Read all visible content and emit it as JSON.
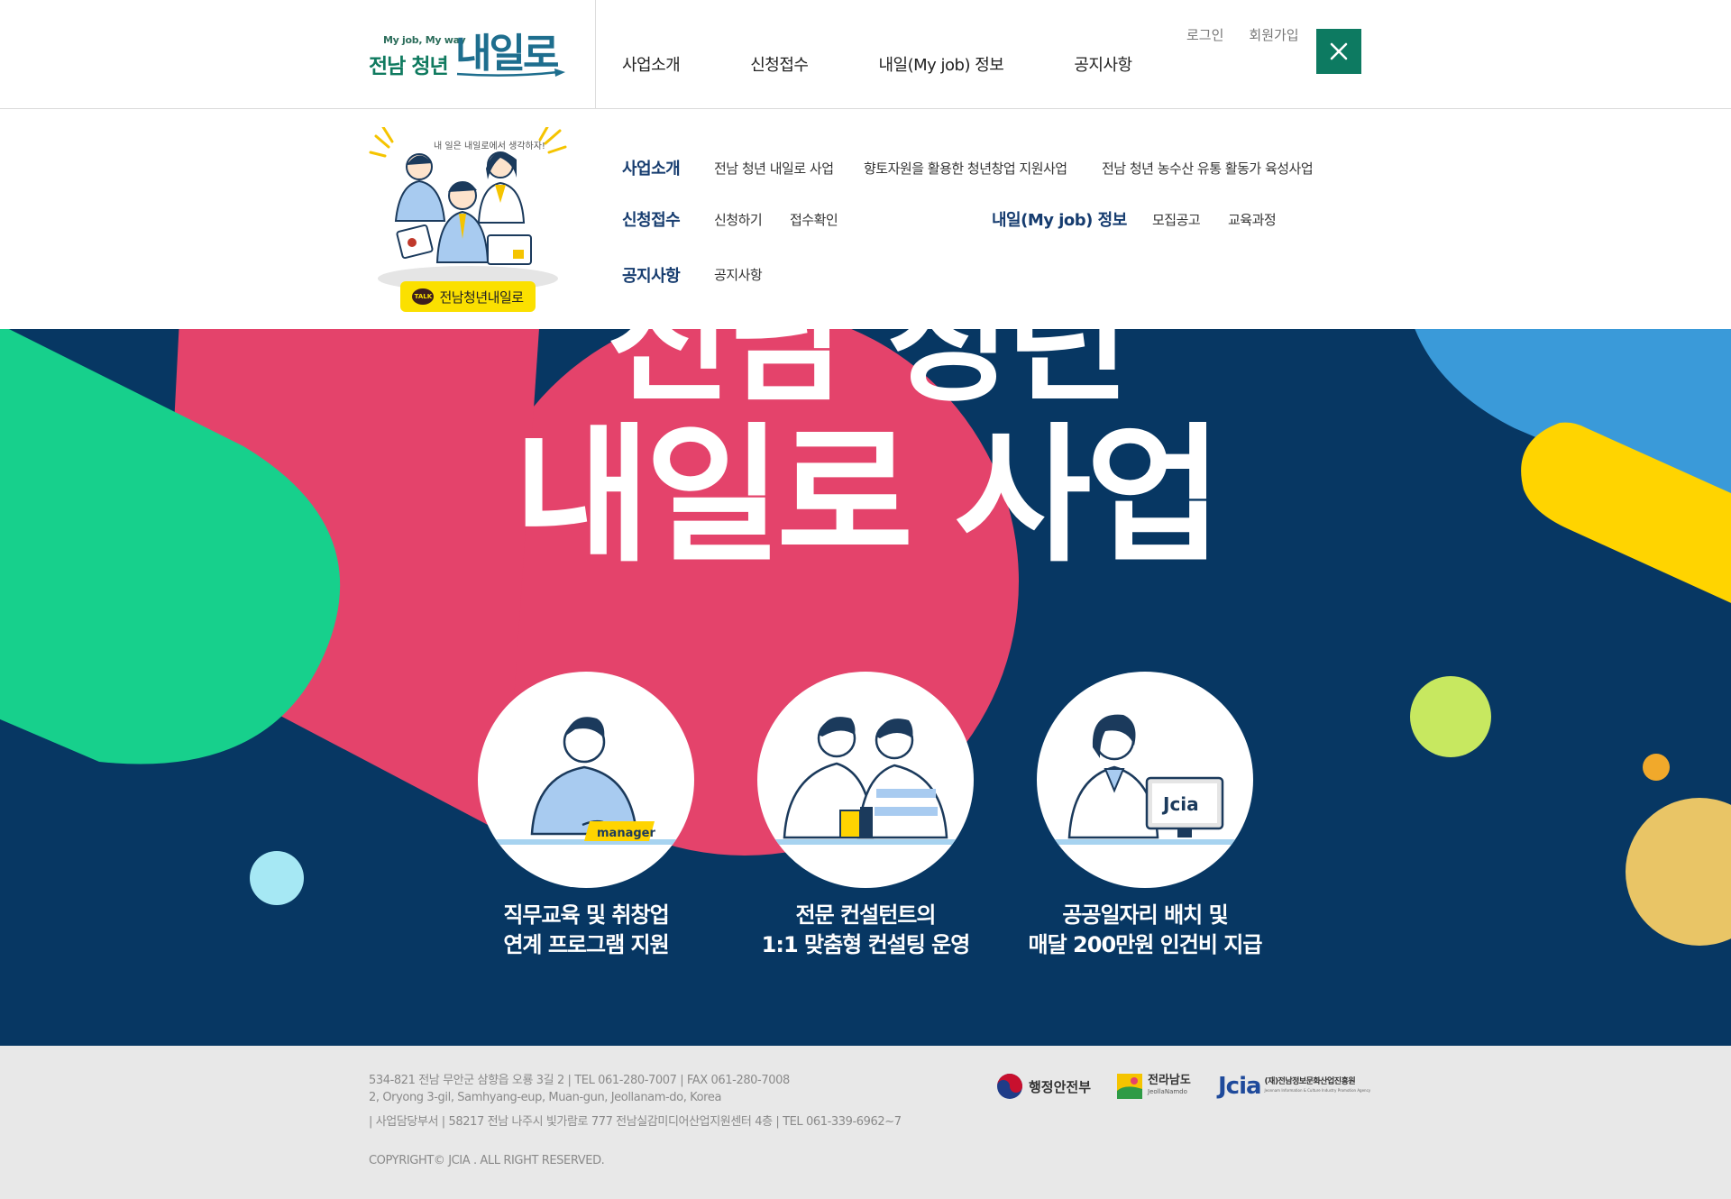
{
  "header": {
    "logo_sub": "My job, My way",
    "logo_main": "전남 청년",
    "logo_big": "내일로",
    "nav": [
      "사업소개",
      "신청접수",
      "내일(My job) 정보",
      "공지사항"
    ],
    "login": "로그인",
    "signup": "회원가입"
  },
  "mega": {
    "illust_caption": "내 일은 내일로에서 생각하자!",
    "kakao_badge": "TALK",
    "kakao_label": "전남청년내일로",
    "business": {
      "title": "사업소개",
      "links": [
        "전남 청년 내일로 사업",
        "향토자원을 활용한 청년창업 지원사업",
        "전남 청년 농수산 유통 활동가 육성사업"
      ]
    },
    "apply": {
      "title": "신청접수",
      "links": [
        "신청하기",
        "접수확인"
      ]
    },
    "info": {
      "title": "내일(My job) 정보",
      "links": [
        "모집공고",
        "교육과정"
      ]
    },
    "notice": {
      "title": "공지사항",
      "links": [
        "공지사항"
      ]
    }
  },
  "hero": {
    "line1": "전남 청년",
    "line2": "내일로 사업",
    "features": [
      {
        "line1": "직무교육 및 취창업",
        "line2": "연계 프로그램 지원",
        "badge": "manager"
      },
      {
        "line1": "전문 컨설턴트의",
        "line2": "1:1 맞춤형 컨설팅 운영"
      },
      {
        "line1": "공공일자리 배치 및",
        "line2": "매달 200만원 인건비 지급",
        "badge": "Jcia"
      }
    ]
  },
  "footer": {
    "address": "534-821 전남 무안군 삼향읍 오룡 3길 2  |  TEL 061-280-7007  |  FAX 061-280-7008",
    "address_en": "2, Oryong 3-gil, Samhyang-eup, Muan-gun, Jeollanam-do, Korea",
    "office": "| 사업담당부서 | 58217 전남 나주시 빛가람로 777 전남실감미디어산업지원센터 4층  |  TEL 061-339-6962~7",
    "copyright": "COPYRIGHT© JCIA . ALL RIGHT RESERVED.",
    "partners": {
      "mois": "행정안전부",
      "jeonnam": "전라남도",
      "jeonnam_en": "JeollaNamdo",
      "jcia": "Jcia",
      "jcia_name": "(재)전남정보문화산업진흥원",
      "jcia_en": "Jeonnam Information & Culture Industry Promotion Agency"
    }
  },
  "colors": {
    "brand_green": "#0d7a61",
    "navy": "#073763",
    "pink": "#e4436b",
    "mint": "#17d08c",
    "sky": "#3a9ad9",
    "yellow": "#ffd400",
    "lime": "#c7e860",
    "gold": "#f1a92b",
    "sand": "#e9c566",
    "ice": "#a6e8f4",
    "kakao": "#fbe000"
  }
}
